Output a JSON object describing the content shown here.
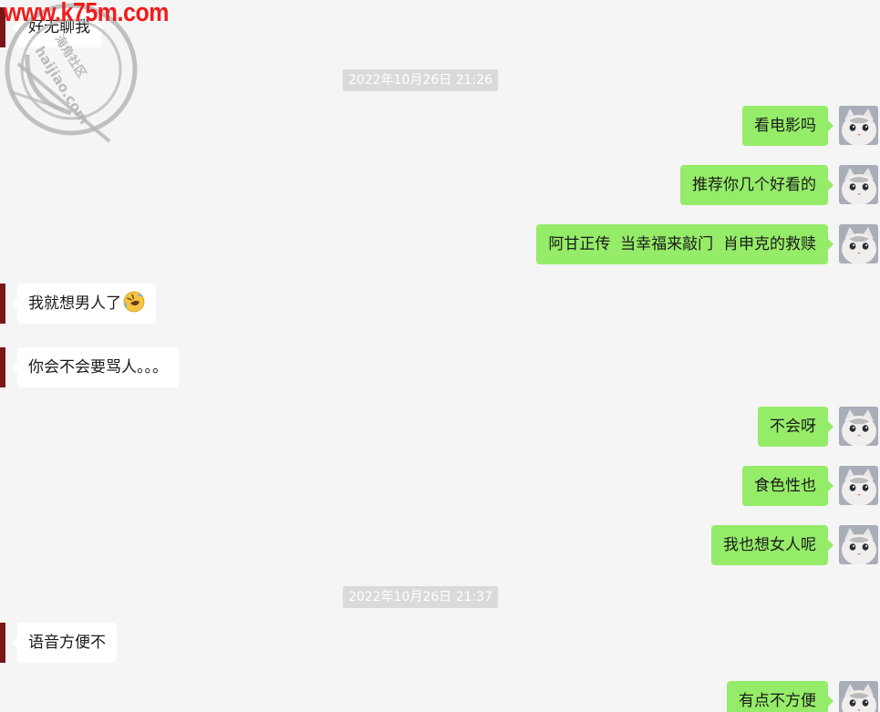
{
  "watermark": {
    "url": "www.k75m.com",
    "logo_text_cn": "海角社区",
    "logo_text_en": "haijiao.com"
  },
  "messages": [
    {
      "type": "incoming",
      "text": "好无聊我"
    },
    {
      "type": "timestamp",
      "text": "2022年10月26日 21:26"
    },
    {
      "type": "outgoing",
      "text": "看电影吗"
    },
    {
      "type": "outgoing",
      "text": "推荐你几个好看的"
    },
    {
      "type": "outgoing",
      "text": "阿甘正传  当幸福来敲门  肖申克的救赎"
    },
    {
      "type": "incoming",
      "text": "我就想男人了",
      "emoji": "rofl-emoji"
    },
    {
      "type": "incoming",
      "text": "你会不会要骂人。。。"
    },
    {
      "type": "outgoing",
      "text": "不会呀"
    },
    {
      "type": "outgoing",
      "text": "食色性也"
    },
    {
      "type": "outgoing",
      "text": "我也想女人呢"
    },
    {
      "type": "timestamp",
      "text": "2022年10月26日 21:37"
    },
    {
      "type": "incoming",
      "text": "语音方便不"
    },
    {
      "type": "outgoing",
      "text": "有点不方便"
    }
  ],
  "colors": {
    "background": "#f5f5f5",
    "incoming_bubble": "#ffffff",
    "outgoing_bubble": "#95ec69",
    "timestamp_bg": "#dadada",
    "contact_avatar": "#7a1618",
    "watermark_red": "#f21b1b"
  },
  "icons": {
    "contact_avatar": "dark-red-avatar",
    "self_avatar": "white-cat-avatar",
    "watermark_logo": "haijiao-circle-logo-icon"
  }
}
